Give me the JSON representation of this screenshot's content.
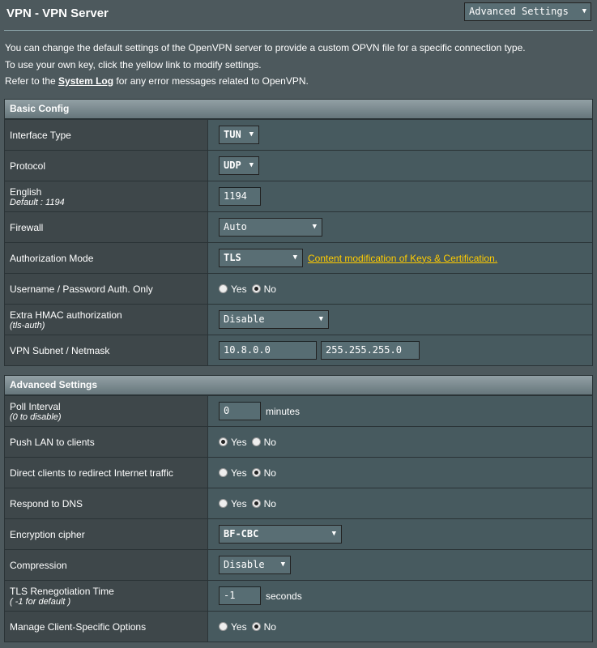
{
  "page": {
    "title": "VPN - VPN Server",
    "mode_select": "Advanced Settings",
    "desc_line1": "You can change the default settings of the OpenVPN server to provide a custom OPVN file for a specific connection type.",
    "desc_line2": "To use your own key, click the yellow link to modify settings.",
    "desc_line3_pre": "Refer to the",
    "desc_line3_link": "System Log",
    "desc_line3_post": "for any error messages related to OpenVPN."
  },
  "basic": {
    "header": "Basic Config",
    "interface_type": {
      "label": "Interface Type",
      "value": "TUN"
    },
    "protocol": {
      "label": "Protocol",
      "value": "UDP"
    },
    "port": {
      "label": "English",
      "sub": "Default : 1194",
      "value": "1194"
    },
    "firewall": {
      "label": "Firewall",
      "value": "Auto"
    },
    "auth_mode": {
      "label": "Authorization Mode",
      "value": "TLS",
      "link": "Content modification of Keys & Certification."
    },
    "userpass": {
      "label": "Username / Password Auth. Only",
      "yes": "Yes",
      "no": "No"
    },
    "hmac": {
      "label": "Extra HMAC authorization",
      "sub": "(tls-auth)",
      "value": "Disable"
    },
    "subnet": {
      "label": "VPN Subnet / Netmask",
      "subnet": "10.8.0.0",
      "netmask": "255.255.255.0"
    }
  },
  "advanced": {
    "header": "Advanced Settings",
    "poll": {
      "label": "Poll Interval",
      "sub": "(0 to disable)",
      "value": "0",
      "unit": "minutes"
    },
    "push_lan": {
      "label": "Push LAN to clients",
      "yes": "Yes",
      "no": "No"
    },
    "redirect": {
      "label": "Direct clients to redirect Internet traffic",
      "yes": "Yes",
      "no": "No"
    },
    "dns": {
      "label": "Respond to DNS",
      "yes": "Yes",
      "no": "No"
    },
    "cipher": {
      "label": "Encryption cipher",
      "value": "BF-CBC"
    },
    "compression": {
      "label": "Compression",
      "value": "Disable"
    },
    "tls_reneg": {
      "label": "TLS Renegotiation Time",
      "sub": "( -1 for default )",
      "value": "-1",
      "unit": "seconds"
    },
    "client_specific": {
      "label": "Manage Client-Specific Options",
      "yes": "Yes",
      "no": "No"
    }
  }
}
